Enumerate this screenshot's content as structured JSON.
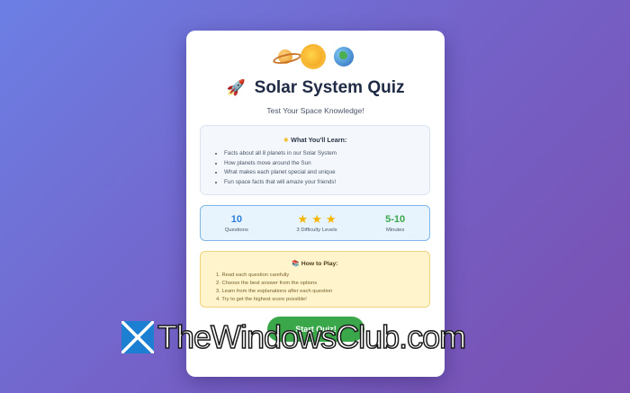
{
  "header": {
    "icons": [
      "saturn-icon",
      "sun-icon",
      "earth-icon"
    ],
    "title": "Solar System Quiz",
    "subtitle": "Test Your Space Knowledge!"
  },
  "learn": {
    "heading": "What You'll Learn:",
    "items": [
      "Facts about all 8 planets in our Solar System",
      "How planets move around the Sun",
      "What makes each planet special and unique",
      "Fun space facts that will amaze your friends!"
    ]
  },
  "stats": [
    {
      "value": "10",
      "label": "Questions",
      "color": "#2b7fd8"
    },
    {
      "stars": 3,
      "label": "3 Difficulty Levels",
      "color": "#f4b400"
    },
    {
      "value": "5-10",
      "label": "Minutes",
      "color": "#3aa84a"
    }
  ],
  "howto": {
    "heading": "How to Play:",
    "steps": [
      "1. Read each question carefully",
      "2. Choose the best answer from the options",
      "3. Learn from the explanations after each question",
      "4. Try to get the highest score possible!"
    ]
  },
  "start_button": "Start Quiz!",
  "watermark": "TheWindowsClub.com",
  "colors": {
    "accent_green": "#3aa84a",
    "accent_blue": "#2b7fd8",
    "title": "#1f2a44"
  }
}
